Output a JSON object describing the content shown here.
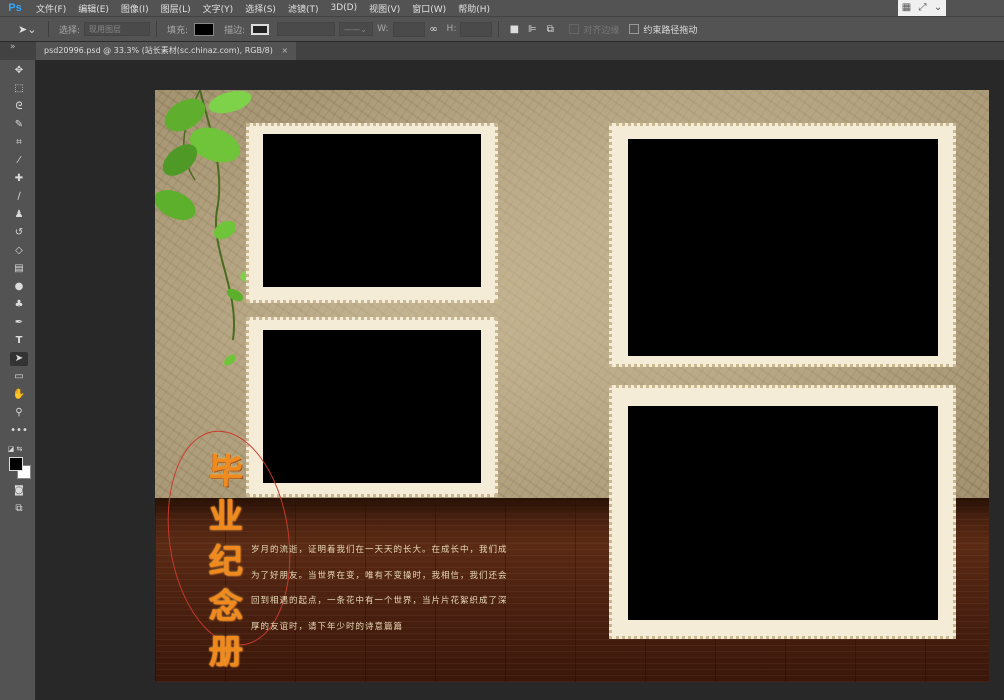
{
  "app": {
    "logo": "Ps"
  },
  "menu": [
    "文件(F)",
    "编辑(E)",
    "图像(I)",
    "图层(L)",
    "文字(Y)",
    "选择(S)",
    "滤镜(T)",
    "3D(D)",
    "视图(V)",
    "窗口(W)",
    "帮助(H)"
  ],
  "options": {
    "select_label": "选择:",
    "select_value": "现用图层",
    "fill_label": "填充:",
    "stroke_label": "描边:",
    "w_label": "W:",
    "h_label": "H:",
    "align_edges": "对齐边缘",
    "constrain_path": "约束路径拖动"
  },
  "document": {
    "tab_label": "psd20996.psd @ 33.3% (站长素材(sc.chinaz.com), RGB/8)",
    "tab_close": "×",
    "title_chars": [
      "毕",
      "业",
      "纪",
      "念",
      "册"
    ],
    "poem_lines": [
      "岁月的流逝，证明着我们在一天天的长大。在成长中，我们成",
      "为了好朋友。当世界在变，唯有不变操时，我相信，我们还会",
      "回到相遇的起点，一条花中有一个世界，当片片花絮织成了深",
      "厚的友谊时，请下年少时的诗意篇篇"
    ]
  },
  "colors": {
    "title": "#f08a1c",
    "ellipse": "#c83a2e",
    "stamp_border": "#f4ecd6",
    "floor": "#4a2010"
  },
  "icons": {
    "tools": [
      "move-icon",
      "marquee-icon",
      "lasso-icon",
      "quick-select-icon",
      "crop-icon",
      "eyedropper-icon",
      "healing-brush-icon",
      "brush-icon",
      "clone-stamp-icon",
      "history-brush-icon",
      "eraser-icon",
      "gradient-icon",
      "blur-icon",
      "dodge-icon",
      "pen-icon",
      "type-icon",
      "path-select-icon",
      "rectangle-icon",
      "hand-icon",
      "zoom-icon",
      "more-icon"
    ]
  }
}
